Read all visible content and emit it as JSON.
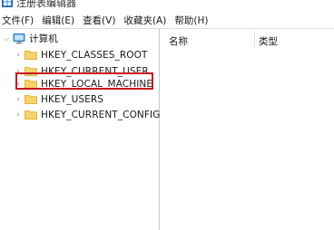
{
  "window": {
    "title": "注册表编辑器"
  },
  "menu": {
    "items": [
      "文件(F)",
      "编辑(E)",
      "查看(V)",
      "收藏夹(A)",
      "帮助(H)"
    ]
  },
  "tree": {
    "root": {
      "label": "计算机",
      "expanded": true,
      "icon": "computer-icon"
    },
    "children": [
      {
        "label": "HKEY_CLASSES_ROOT",
        "icon": "folder-icon"
      },
      {
        "label": "HKEY_CURRENT_USER",
        "icon": "folder-icon"
      },
      {
        "label": "HKEY_LOCAL_MACHINE",
        "icon": "folder-icon",
        "highlighted": true
      },
      {
        "label": "HKEY_USERS",
        "icon": "folder-icon"
      },
      {
        "label": "HKEY_CURRENT_CONFIG",
        "icon": "folder-icon"
      }
    ]
  },
  "list": {
    "columns": [
      "名称",
      "类型"
    ]
  },
  "colors": {
    "highlight_border": "#c8161d",
    "folder_fill": "#f6d36b",
    "folder_edge": "#e0b53c"
  }
}
